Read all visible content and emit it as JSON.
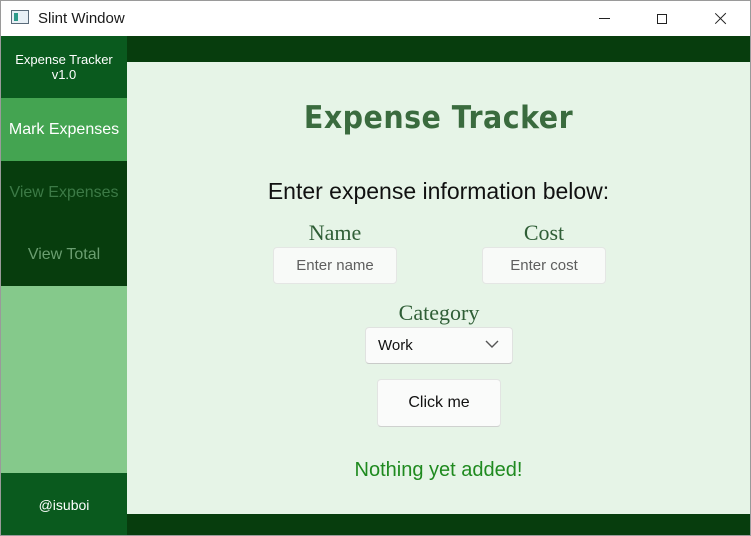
{
  "window": {
    "title": "Slint Window"
  },
  "sidebar": {
    "header_line1": "Expense Tracker",
    "header_line2": "v1.0",
    "items": [
      {
        "label": "Mark Expenses"
      },
      {
        "label": "View Expenses"
      },
      {
        "label": "View Total"
      }
    ],
    "footer": "@isuboi"
  },
  "main": {
    "heading": "Expense Tracker",
    "subheading": "Enter expense information below:",
    "name_label": "Name",
    "name_placeholder": "Enter name",
    "cost_label": "Cost",
    "cost_placeholder": "Enter cost",
    "category_label": "Category",
    "category_selected": "Work",
    "button_label": "Click me",
    "status": "Nothing yet added!"
  },
  "colors": {
    "dark_green": "#073d0d",
    "header_green": "#0a5a1e",
    "active_green": "#44a451",
    "sidebar_fill": "#85c98b",
    "content_bg": "#e6f4e7",
    "heading_green": "#3a6b3e",
    "status_green": "#1f8a1f"
  },
  "icons": {
    "app": "slint-window-icon",
    "minimize": "minimize-icon",
    "maximize": "maximize-icon",
    "close": "close-icon",
    "dropdown": "chevron-down-icon"
  }
}
